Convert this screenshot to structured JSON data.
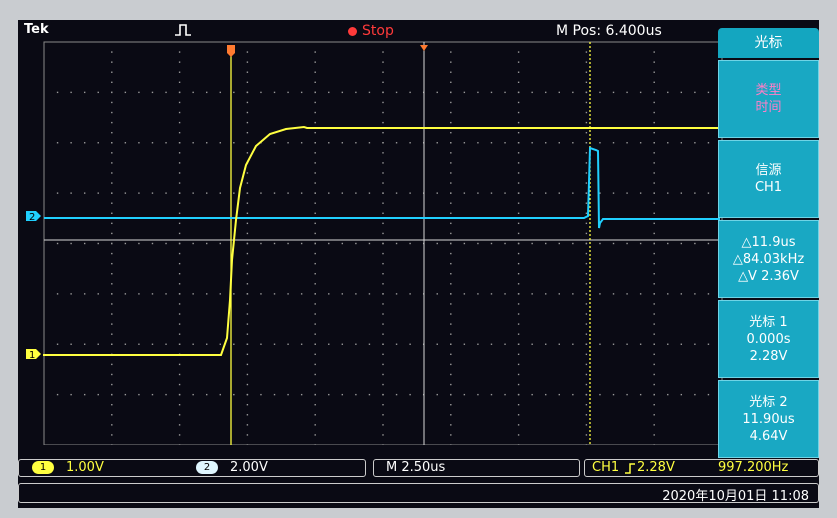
{
  "topbar": {
    "brand": "Tek",
    "acquisition_status": "Stop",
    "horizontal_position": "M Pos: 6.400us"
  },
  "channels": {
    "ch1": {
      "marker": "1",
      "color": "#ffff40"
    },
    "ch2": {
      "marker": "2",
      "color": "#20d0ff"
    }
  },
  "menu": {
    "title": "光标",
    "buttons": [
      {
        "lines": [
          "类型",
          "时间"
        ],
        "style": "pink"
      },
      {
        "lines": [
          "信源",
          "CH1"
        ],
        "style": "normal"
      },
      {
        "lines": [
          "△11.9us",
          "△84.03kHz",
          "△V 2.36V"
        ],
        "style": "normal"
      },
      {
        "lines": [
          "光标 1",
          "0.000s",
          "2.28V"
        ],
        "style": "normal"
      },
      {
        "lines": [
          "光标 2",
          "11.90us",
          "4.64V"
        ],
        "style": "normal"
      }
    ]
  },
  "status": {
    "ch1_badge": "1",
    "ch1_scale": "1.00V",
    "ch2_badge": "2",
    "ch2_scale": "2.00V",
    "timebase": "M 2.50us",
    "trigger_source": "CH1",
    "trigger_level": "2.28V",
    "frequency": "997.200Hz",
    "datetime": "2020年10月01日 11:08"
  },
  "colors": {
    "ch1": "#ffff40",
    "ch2": "#20d0ff",
    "menu_bg": "#19a8c3",
    "stop": "#ff3a3a",
    "trigger_marker": "#ff7a30"
  }
}
